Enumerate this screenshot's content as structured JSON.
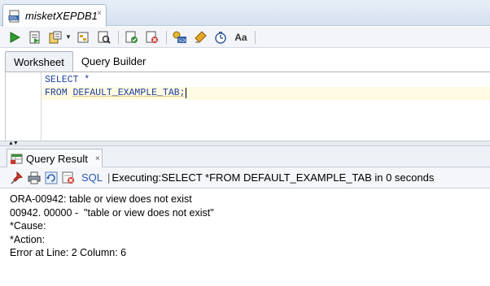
{
  "document_tab": {
    "title": "misketXEPDB1",
    "close_glyph": "×",
    "icon": "sql-file-icon"
  },
  "toolbar": {
    "icons": [
      "run-statement-icon",
      "run-script-icon",
      "commit-icon",
      "dropdown-arrow",
      "explain-plan-icon",
      "autotrace-icon",
      "sql-tuning-icon",
      "rollback-icon",
      "sql-history-icon",
      "clear-icon",
      "format-icon",
      "unshared-worksheet-icon",
      "case-icon"
    ],
    "dropdown_glyph": "▼",
    "case_label": "Aa"
  },
  "worksheet_tabs": [
    {
      "label": "Worksheet",
      "active": true
    },
    {
      "label": "Query Builder",
      "active": false
    }
  ],
  "editor": {
    "lines": [
      "SELECT *",
      "FROM DEFAULT_EXAMPLE_TAB;"
    ],
    "line2_keyword": "FROM ",
    "line2_object": "DEFAULT_EXAMPLE_TAB;"
  },
  "splitter": {
    "arrows": "▲▼"
  },
  "result_panel": {
    "tab_label": "Query Result",
    "close_glyph": "×",
    "sql_link": "SQL",
    "separator": "|",
    "status": "Executing:SELECT *FROM DEFAULT_EXAMPLE_TAB in 0 seconds",
    "lines": [
      "ORA-00942: table or view does not exist",
      "00942. 00000 -  \"table or view does not exist\"",
      "*Cause:",
      "*Action:",
      "Error at Line: 2 Column: 6"
    ]
  },
  "colors": {
    "keyword": "#1d3c9b",
    "current_line": "#fffbe3",
    "link": "#2757b6"
  }
}
